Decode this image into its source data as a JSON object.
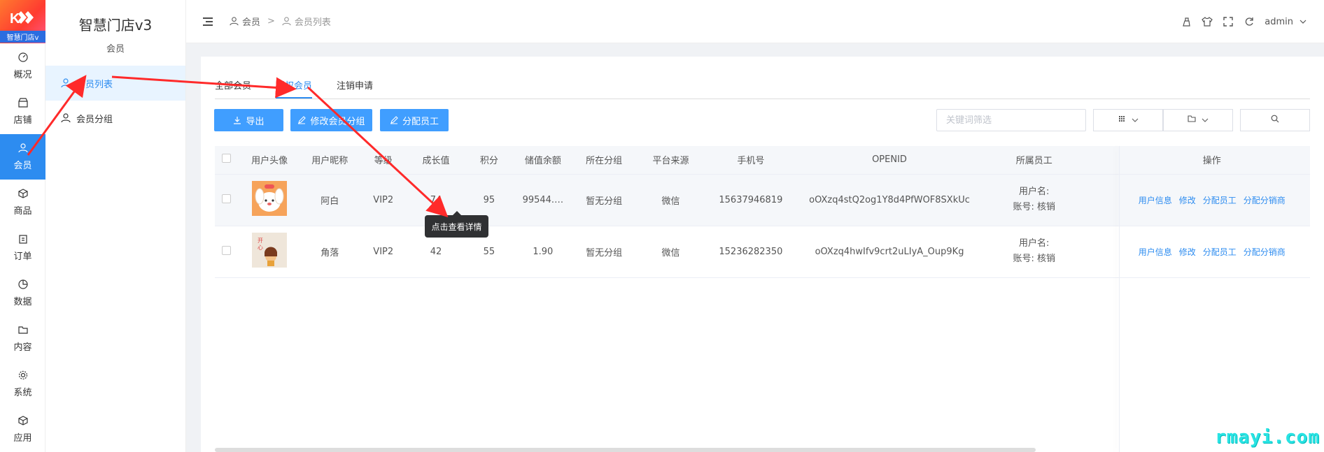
{
  "brand": {
    "logo_text": "智慧门店v"
  },
  "rail": {
    "items": [
      {
        "label": "概况",
        "icon": "dashboard-icon"
      },
      {
        "label": "店铺",
        "icon": "store-icon"
      },
      {
        "label": "会员",
        "icon": "user-icon",
        "active": true
      },
      {
        "label": "商品",
        "icon": "box-icon"
      },
      {
        "label": "订单",
        "icon": "clipboard-icon"
      },
      {
        "label": "数据",
        "icon": "pie-icon"
      },
      {
        "label": "内容",
        "icon": "folder-icon"
      },
      {
        "label": "系统",
        "icon": "gear-icon"
      },
      {
        "label": "应用",
        "icon": "cube-icon"
      }
    ]
  },
  "subnav": {
    "title": "智慧门店v3",
    "subtitle": "会员",
    "items": [
      {
        "label": "会员列表",
        "active": true
      },
      {
        "label": "会员分组"
      }
    ]
  },
  "header": {
    "breadcrumb": [
      "会员",
      "会员列表"
    ],
    "separator": ">",
    "user": "admin"
  },
  "tabs": [
    "全部会员",
    "授权会员",
    "注销申请"
  ],
  "toolbar": {
    "export_label": "导出",
    "edit_group_label": "修改会员分组",
    "assign_staff_label": "分配员工",
    "search_placeholder": "关键词筛选"
  },
  "table": {
    "columns": [
      "用户头像",
      "用户昵称",
      "等级",
      "成长值",
      "积分",
      "储值余额",
      "所在分组",
      "平台来源",
      "手机号",
      "OPENID",
      "所属员工",
      "操作"
    ],
    "rows": [
      {
        "nickname": "阿白",
        "level": "VIP2",
        "growth": "74",
        "points": "95",
        "balance": "99544.…",
        "group": "暂无分组",
        "source": "微信",
        "phone": "15637946819",
        "openid": "oOXzq4stQ2og1Y8d4PfWOF8SXkUc",
        "staff_line1": "用户名:",
        "staff_line2": "账号: 核销"
      },
      {
        "nickname": "角落",
        "level": "VIP2",
        "growth": "42",
        "points": "55",
        "balance": "1.90",
        "group": "暂无分组",
        "source": "微信",
        "phone": "15236282350",
        "openid": "oOXzq4hwIfv9crt2uLIyA_Oup9Kg",
        "staff_line1": "用户名:",
        "staff_line2": "账号: 核销"
      }
    ],
    "actions": [
      "用户信息",
      "修改",
      "分配员工",
      "分配分销商"
    ]
  },
  "tooltip": "点击查看详情",
  "watermark": "rmayi.com",
  "colors": {
    "primary": "#2d8cf0",
    "button": "#409eff",
    "annotation": "#ff2a2a",
    "watermark": "#29e3e3"
  }
}
